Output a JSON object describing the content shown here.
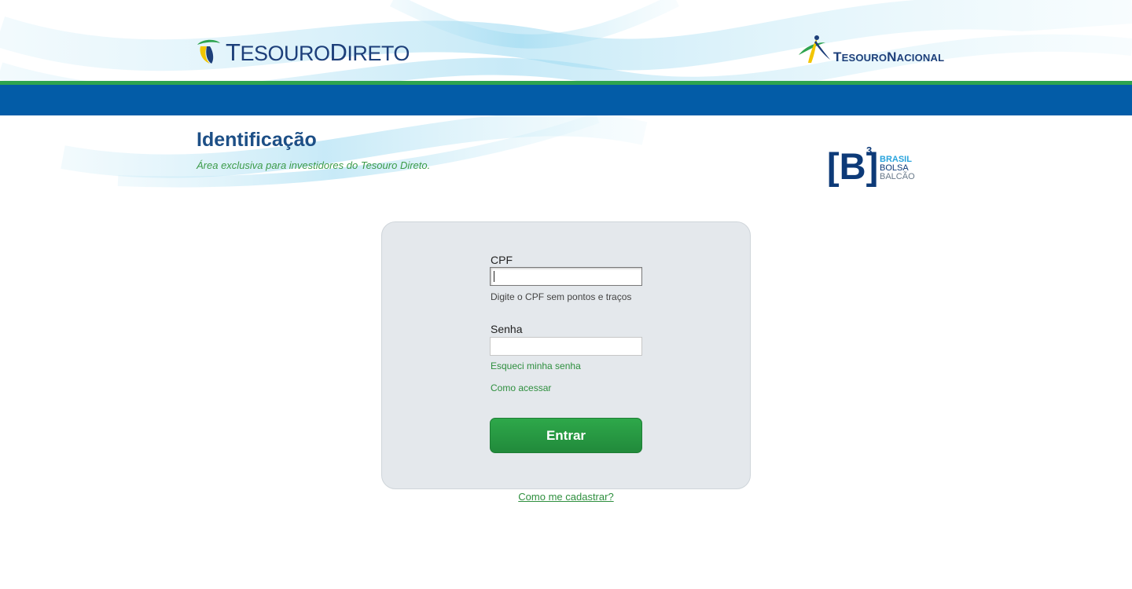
{
  "header": {
    "logo_left": {
      "word1_initial": "T",
      "word1_rest": "ESOURO",
      "word2_initial": "D",
      "word2_rest": "IRETO"
    },
    "logo_right": {
      "word1_initial": "T",
      "word1_rest": "ESOURO",
      "word2_initial": "N",
      "word2_rest": "ACIONAL"
    }
  },
  "page": {
    "title": "Identificação",
    "subtitle": "Área exclusiva para investidores do Tesouro Direto."
  },
  "partner_logo": {
    "letter": "[B]",
    "superscript": "3",
    "line1": "BRASIL",
    "line2": "BOLSA",
    "line3": "BALCÃO"
  },
  "login": {
    "cpf_label": "CPF",
    "cpf_value": "",
    "cpf_hint": "Digite o CPF sem pontos e traços",
    "senha_label": "Senha",
    "senha_value": "",
    "forgot_link": "Esqueci minha senha",
    "how_link": "Como acessar",
    "submit_label": "Entrar",
    "register_link": "Como me cadastrar?"
  },
  "colors": {
    "brand_blue": "#035ca7",
    "brand_green": "#2ea44f",
    "title_blue": "#1d4f86",
    "link_green": "#2e8f3e",
    "card_bg": "#e4e8ec"
  }
}
